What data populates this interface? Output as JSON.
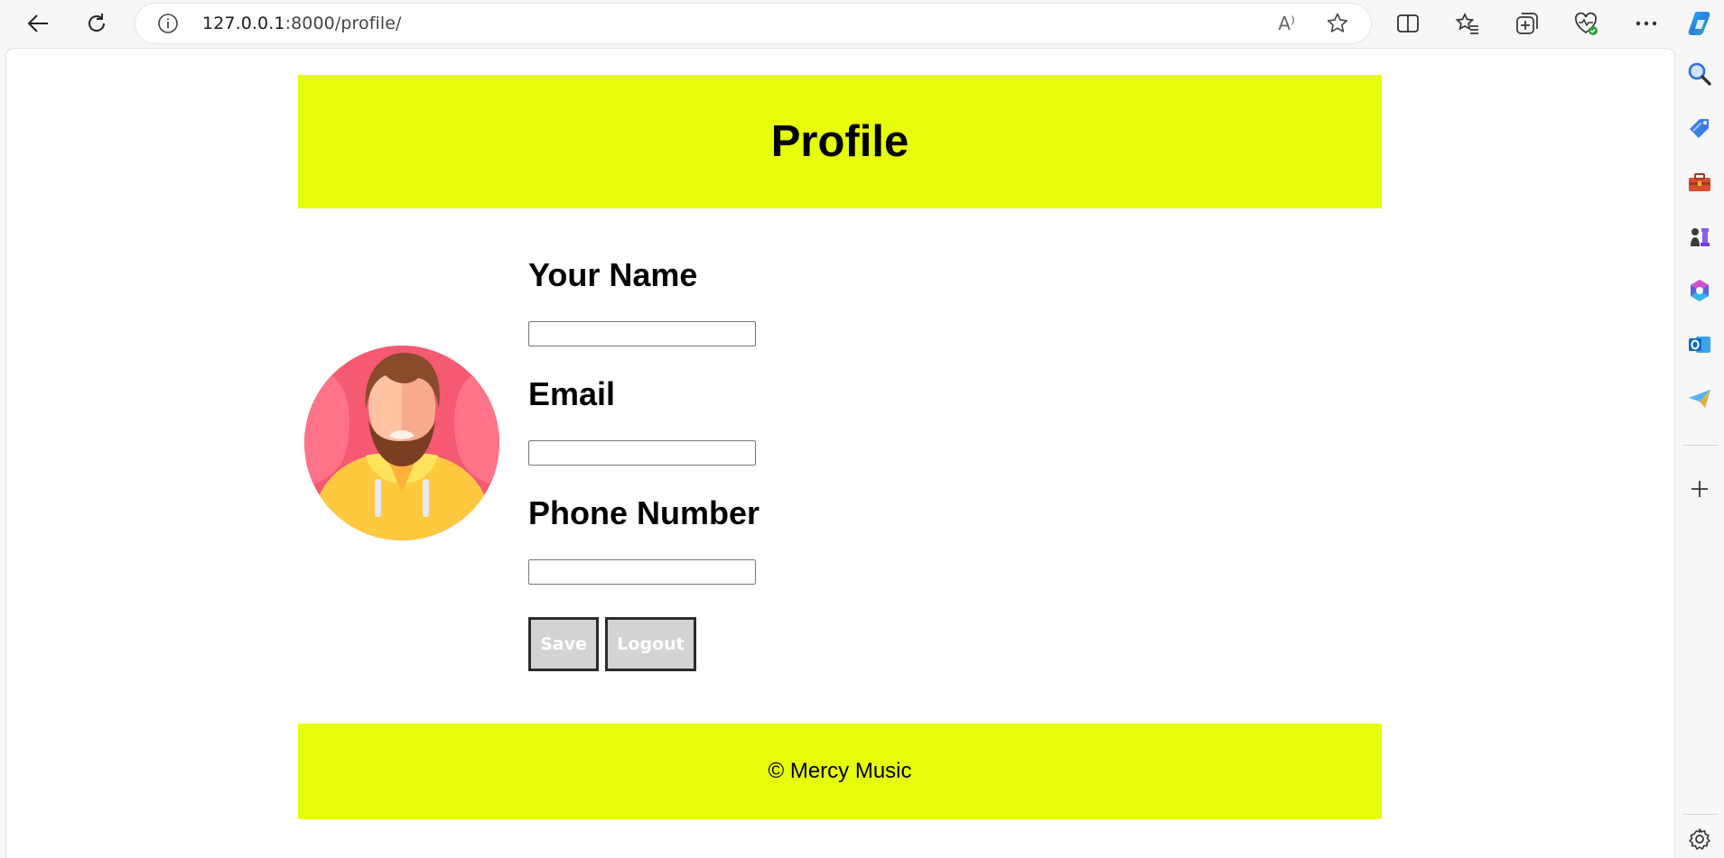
{
  "browser": {
    "url_host": "127.0.0.1",
    "url_path": ":8000/profile/",
    "read_aloud_label": "A⁾",
    "icons": [
      "back-icon",
      "refresh-icon",
      "info-icon",
      "read-aloud-icon",
      "favorite-star-icon",
      "split-screen-icon",
      "favorites-icon",
      "collections-icon",
      "browser-essentials-icon",
      "more-icon",
      "copilot-icon"
    ]
  },
  "sidebar": {
    "icons": [
      "search-icon",
      "shopping-tag-icon",
      "tools-icon",
      "games-icon",
      "microsoft-365-icon",
      "outlook-icon",
      "drop-icon",
      "add-icon",
      "settings-icon"
    ]
  },
  "page": {
    "title": "Profile",
    "form": {
      "name_label": "Your Name",
      "name_value": "",
      "email_label": "Email",
      "email_value": "",
      "phone_label": "Phone Number",
      "phone_value": "",
      "save_label": "Save",
      "logout_label": "Logout"
    },
    "footer": "© Mercy Music"
  },
  "colors": {
    "accent": "#e6fd0b",
    "button_bg": "#d3d3d3",
    "button_border": "#2b2b2b"
  }
}
